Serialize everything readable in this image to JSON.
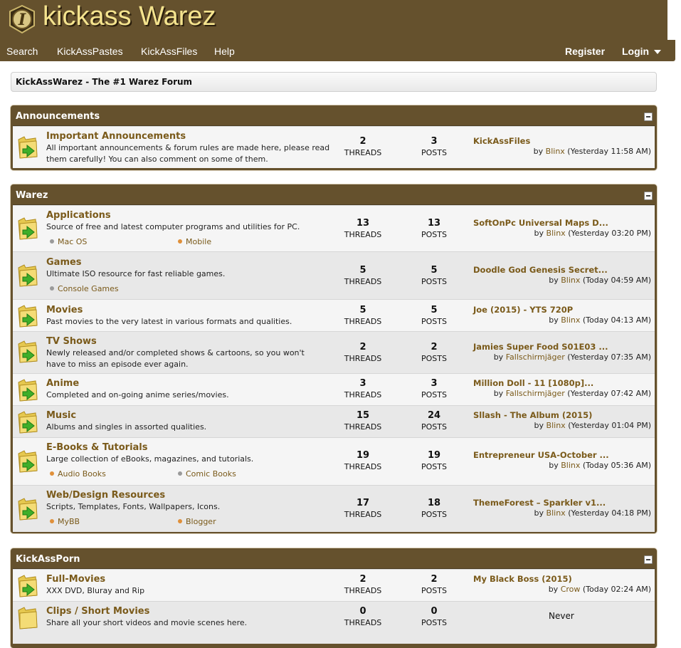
{
  "site": {
    "logo_text": "kickass Warez",
    "logo_glyph": "I",
    "brand_color": "#65512d",
    "accent_color": "#f4e38e",
    "link_color": "#7a5a1a"
  },
  "nav": {
    "left": [
      "Search",
      "KickAssPastes",
      "KickAssFiles",
      "Help"
    ],
    "register": "Register",
    "login": "Login"
  },
  "breadcrumb": "KickAssWarez - The #1 Warez Forum",
  "labels": {
    "threads": "THREADS",
    "posts": "POSTS",
    "by": "by"
  },
  "categories": [
    {
      "name": "Announcements",
      "forums": [
        {
          "title": "Important Announcements",
          "desc": "All important announcements & forum rules are made here, please read them carefully! You can also comment on some of them.",
          "subforums": [],
          "threads": "2",
          "posts": "3",
          "last_title": "KickAssFiles",
          "last_user": "Blinx",
          "last_time": "(Yesterday 11:58 AM)"
        }
      ]
    },
    {
      "name": "Warez",
      "forums": [
        {
          "title": "Applications",
          "desc": "Source of free and latest computer programs and utilities for PC.",
          "subforums": [
            {
              "label": "Mac OS",
              "dot": "#9a9a9a"
            },
            {
              "label": "Mobile",
              "dot": "#e0903a"
            }
          ],
          "threads": "13",
          "posts": "13",
          "last_title": "SoftOnPc Universal Maps D...",
          "last_user": "Blinx",
          "last_time": "(Yesterday 03:20 PM)"
        },
        {
          "title": "Games",
          "desc": "Ultimate ISO resource for fast reliable games.",
          "subforums": [
            {
              "label": "Console Games",
              "dot": "#9a9a9a"
            }
          ],
          "threads": "5",
          "posts": "5",
          "last_title": "Doodle God Genesis Secret...",
          "last_user": "Blinx",
          "last_time": "(Today 04:59 AM)"
        },
        {
          "title": "Movies",
          "desc": "Past movies to the very latest in various formats and qualities.",
          "subforums": [],
          "threads": "5",
          "posts": "5",
          "last_title": "Joe (2015) - YTS 720P",
          "last_user": "Blinx",
          "last_time": "(Today 04:13 AM)"
        },
        {
          "title": "TV Shows",
          "desc": "Newly released and/or completed shows & cartoons, so you won't have to miss an episode ever again.",
          "subforums": [],
          "threads": "2",
          "posts": "2",
          "last_title": "Jamies Super Food S01E03 ...",
          "last_user": "Fallschirmjäger",
          "last_time": "(Yesterday 07:35 AM)"
        },
        {
          "title": "Anime",
          "desc": "Completed and on-going anime series/movies.",
          "subforums": [],
          "threads": "3",
          "posts": "3",
          "last_title": "Million Doll - 11 [1080p]...",
          "last_user": "Fallschirmjäger",
          "last_time": "(Yesterday 07:42 AM)"
        },
        {
          "title": "Music",
          "desc": "Albums and singles in assorted qualities.",
          "subforums": [],
          "threads": "15",
          "posts": "24",
          "last_title": "Sllash - The Album (2015)",
          "last_user": "Blinx",
          "last_time": "(Yesterday 01:04 PM)"
        },
        {
          "title": "E-Books & Tutorials",
          "desc": "Large collection of eBooks, magazines, and tutorials.",
          "subforums": [
            {
              "label": "Audio Books",
              "dot": "#e0903a"
            },
            {
              "label": "Comic Books",
              "dot": "#9a9a9a"
            }
          ],
          "threads": "19",
          "posts": "19",
          "last_title": "Entrepreneur USA-October ...",
          "last_user": "Blinx",
          "last_time": "(Today 05:36 AM)"
        },
        {
          "title": "Web/Design Resources",
          "desc": "Scripts, Templates, Fonts, Wallpapers, Icons.",
          "subforums": [
            {
              "label": "MyBB",
              "dot": "#e0903a"
            },
            {
              "label": "Blogger",
              "dot": "#e0903a"
            }
          ],
          "threads": "17",
          "posts": "18",
          "last_title": "ThemeForest – Sparkler v1...",
          "last_user": "Blinx",
          "last_time": "(Yesterday 04:18 PM)"
        }
      ]
    },
    {
      "name": "KickAssPorn",
      "forums": [
        {
          "title": "Full-Movies",
          "desc": "XXX DVD, Bluray and Rip",
          "subforums": [],
          "threads": "2",
          "posts": "2",
          "last_title": "My Black Boss (2015)",
          "last_user": "Crow",
          "last_time": "(Today 02:24 AM)"
        },
        {
          "title": "Clips / Short Movies",
          "desc": "Share all your short videos and movie scenes here.",
          "subforums": [],
          "threads": "0",
          "posts": "0",
          "never": "Never"
        }
      ]
    }
  ]
}
